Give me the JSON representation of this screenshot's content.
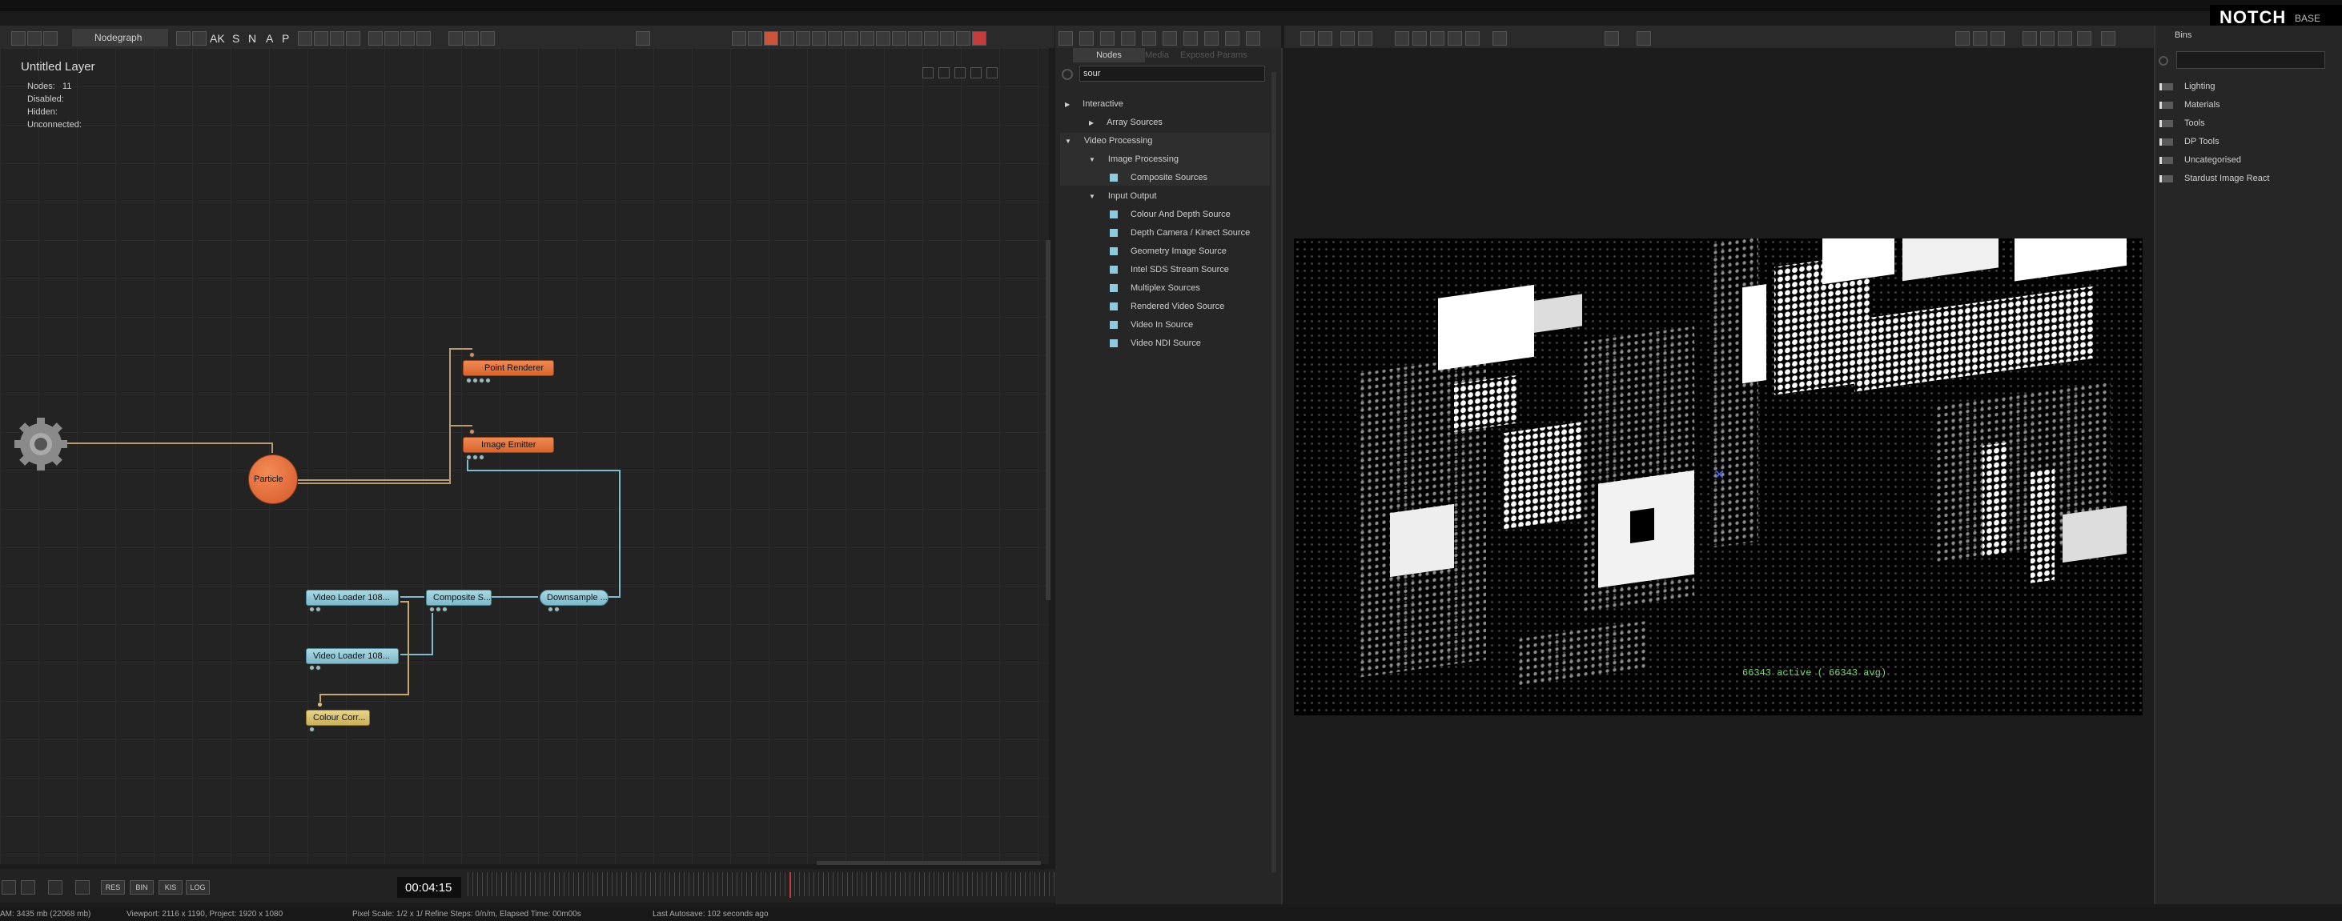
{
  "toolbar": {
    "nodegraph_label": "Nodegraph",
    "letters": [
      "AK",
      "S",
      "N",
      "A",
      "P"
    ]
  },
  "layer": {
    "title": "Untitled Layer",
    "stats": [
      {
        "label": "Nodes:",
        "value": "11"
      },
      {
        "label": "Disabled:",
        "value": ""
      },
      {
        "label": "Hidden:",
        "value": ""
      },
      {
        "label": "Unconnected:",
        "value": ""
      }
    ]
  },
  "nodes": {
    "point_renderer": "Point Renderer",
    "image_emitter": "Image Emitter",
    "particle": "Particle",
    "video_loader_1": "Video Loader 108...",
    "video_loader_2": "Video Loader 108...",
    "composite": "Composite S...",
    "downsample": "Downsample ...",
    "colour_corr": "Colour Corr..."
  },
  "node_browser": {
    "tabs": [
      "Nodes",
      "Media",
      "Exposed Params"
    ],
    "search_value": "sour",
    "tree": [
      {
        "label": "Interactive",
        "level": 0,
        "type": "folder"
      },
      {
        "label": "Array Sources",
        "level": 1,
        "type": "folder"
      },
      {
        "label": "Video Processing",
        "level": 0,
        "type": "folder"
      },
      {
        "label": "Image Processing",
        "level": 1,
        "type": "folder"
      },
      {
        "label": "Composite Sources",
        "level": 2,
        "type": "item"
      },
      {
        "label": "Input Output",
        "level": 1,
        "type": "folder"
      },
      {
        "label": "Colour And Depth Source",
        "level": 2,
        "type": "item"
      },
      {
        "label": "Depth Camera / Kinect Source",
        "level": 2,
        "type": "item"
      },
      {
        "label": "Geometry Image Source",
        "level": 2,
        "type": "item"
      },
      {
        "label": "Intel SDS Stream Source",
        "level": 2,
        "type": "item"
      },
      {
        "label": "Multiplex Sources",
        "level": 2,
        "type": "item"
      },
      {
        "label": "Rendered Video Source",
        "level": 2,
        "type": "item"
      },
      {
        "label": "Video In Source",
        "level": 2,
        "type": "item"
      },
      {
        "label": "Video NDI Source",
        "level": 2,
        "type": "item"
      }
    ]
  },
  "viewport": {
    "overlay_text": "66343 active ( 66343 avg)"
  },
  "bins": {
    "title": "Bins",
    "items": [
      "Lighting",
      "Materials",
      "Tools",
      "DP Tools",
      "Uncategorised",
      "Stardust Image React"
    ]
  },
  "brand": {
    "logo": "NOTCH",
    "edition": "BASE"
  },
  "timeline": {
    "timecode": "00:04:15",
    "buttons": [
      "RES",
      "BIN",
      "KIS",
      "LOG"
    ]
  },
  "status": {
    "memory": "AM: 3435 mb (22068 mb)",
    "viewport": "Viewport: 2116 x 1190, Project: 1920 x 1080",
    "pixel": "Pixel Scale: 1/2 x 1/  Refine Steps: 0/n/m, Elapsed Time: 00m00s",
    "autosave": "Last Autosave: 102 seconds ago"
  },
  "colors": {
    "orange_node": "#e37a45",
    "teal_node": "#8cc4d3",
    "yellow_node": "#d8c172",
    "wire": "#c9a66b",
    "wire_teal": "#7ebccc"
  }
}
